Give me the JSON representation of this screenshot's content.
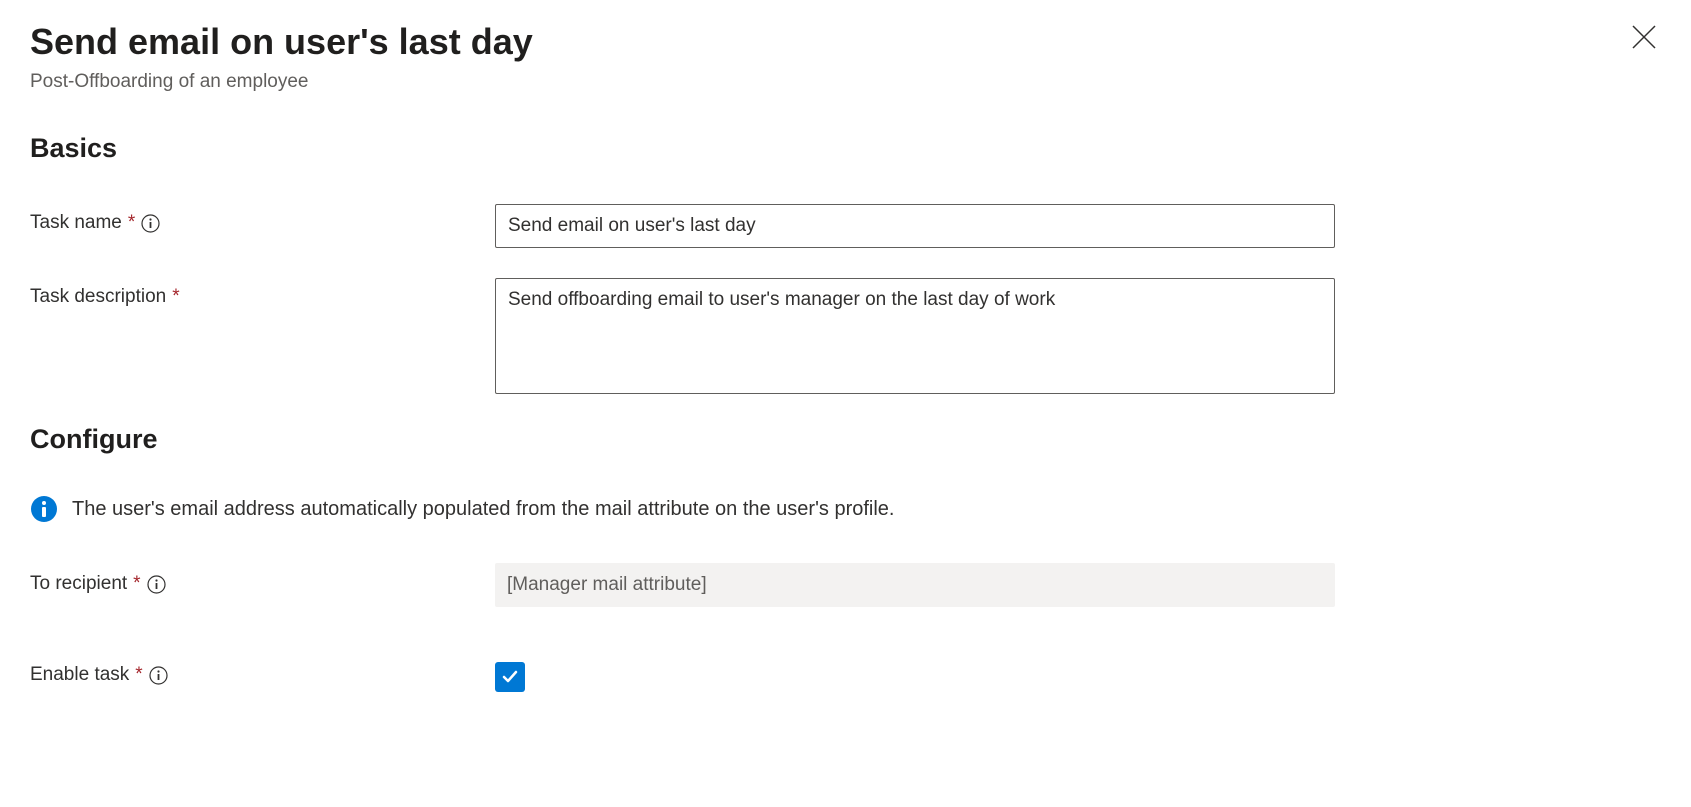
{
  "header": {
    "title": "Send email on user's last day",
    "subtitle": "Post-Offboarding of an employee"
  },
  "sections": {
    "basics": {
      "heading": "Basics",
      "task_name": {
        "label": "Task name",
        "value": "Send email on user's last day"
      },
      "task_description": {
        "label": "Task description",
        "value": "Send offboarding email to user's manager on the last day of work"
      }
    },
    "configure": {
      "heading": "Configure",
      "info_message": "The user's email address automatically populated from the mail attribute on the user's profile.",
      "to_recipient": {
        "label": "To recipient",
        "value": "[Manager mail attribute]"
      },
      "enable_task": {
        "label": "Enable task",
        "checked": true
      }
    }
  },
  "colors": {
    "primary": "#0078d4",
    "required": "#a4262c"
  }
}
